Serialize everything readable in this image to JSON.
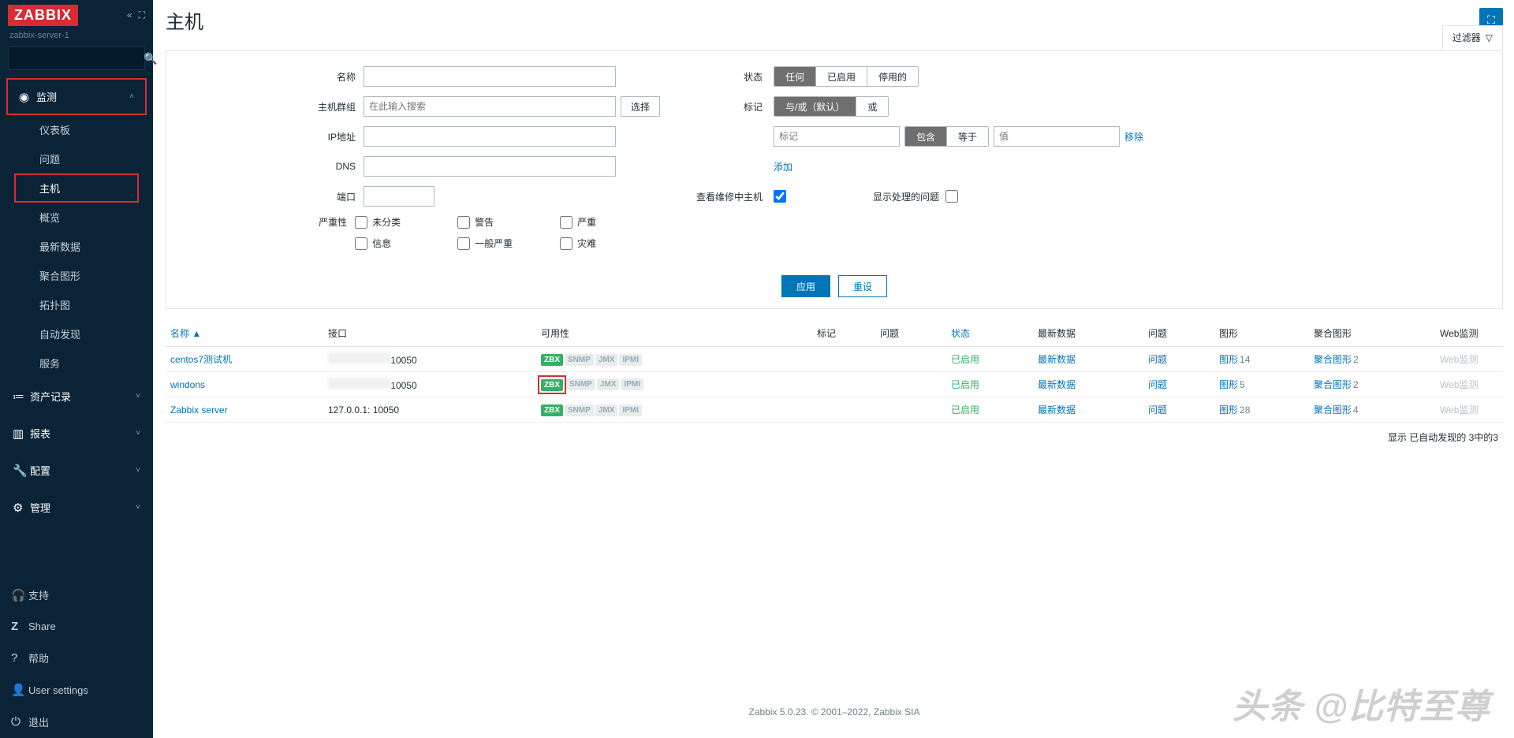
{
  "brand": "ZABBIX",
  "server_name": "zabbix-server-1",
  "page_title": "主机",
  "filter_tab": "过滤器",
  "nav": {
    "sections": [
      {
        "icon": "◉",
        "label": "监测",
        "expanded": true,
        "highlight": true,
        "items": [
          "仪表板",
          "问题",
          "主机",
          "概览",
          "最新数据",
          "聚合图形",
          "拓扑图",
          "自动发现",
          "服务"
        ],
        "highlight_item": "主机"
      },
      {
        "icon": "≔",
        "label": "资产记录"
      },
      {
        "icon": "⬛",
        "label": "报表"
      },
      {
        "icon": "🔧",
        "label": "配置"
      },
      {
        "icon": "⚙",
        "label": "管理"
      }
    ],
    "footer": [
      {
        "icon": "🎧",
        "label": "支持"
      },
      {
        "icon": "Z",
        "label": "Share"
      },
      {
        "icon": "?",
        "label": "帮助"
      },
      {
        "icon": "👤",
        "label": "User settings"
      },
      {
        "icon": "⏻",
        "label": "退出"
      }
    ]
  },
  "filter": {
    "labels": {
      "name": "名称",
      "hostgroup": "主机群组",
      "ip": "IP地址",
      "dns": "DNS",
      "port": "端口",
      "severity": "严重性",
      "status": "状态",
      "tags": "标记",
      "maint": "查看维修中主机",
      "show_issues": "显示处理的问题"
    },
    "hostgroup_placeholder": "在此输入搜索",
    "select_btn": "选择",
    "status_opts": [
      "任何",
      "已启用",
      "停用的"
    ],
    "status_selected": "任何",
    "tag_mode_opts": [
      "与/或（默认）",
      "或"
    ],
    "tag_mode_selected": "与/或（默认）",
    "tag_key_placeholder": "标记",
    "tag_op_opts": [
      "包含",
      "等于"
    ],
    "tag_op_selected": "包含",
    "tag_val_placeholder": "值",
    "tag_remove": "移除",
    "tag_add": "添加",
    "maint_checked": true,
    "show_issues_checked": false,
    "severities": [
      "未分类",
      "警告",
      "严重",
      "信息",
      "一般严重",
      "灾难"
    ],
    "apply": "应用",
    "reset": "重设"
  },
  "table": {
    "headers": {
      "name": "名称",
      "interface": "接口",
      "avail": "可用性",
      "tags": "标记",
      "problems": "问题",
      "status": "状态",
      "latest": "最新数据",
      "problems2": "问题",
      "graphs": "图形",
      "screens": "聚合图形",
      "web": "Web监测"
    },
    "sort_indicator": "▲",
    "avail_tags": [
      "ZBX",
      "SNMP",
      "JMX",
      "IPMI"
    ],
    "rows": [
      {
        "name": "centos7测试机",
        "interface_port": "10050",
        "interface_blur": true,
        "zbx_hl": false,
        "status": "已启用",
        "latest": "最新数据",
        "problems": "问题",
        "graphs": "图形",
        "graphs_n": "14",
        "screens": "聚合图形",
        "screens_n": "2",
        "web": "Web监测"
      },
      {
        "name": "windons",
        "interface_port": "10050",
        "interface_blur": true,
        "zbx_hl": true,
        "status": "已启用",
        "latest": "最新数据",
        "problems": "问题",
        "graphs": "图形",
        "graphs_n": "5",
        "screens": "聚合图形",
        "screens_n": "2",
        "web": "Web监测"
      },
      {
        "name": "Zabbix server",
        "interface": "127.0.0.1: 10050",
        "interface_blur": false,
        "zbx_hl": false,
        "status": "已启用",
        "latest": "最新数据",
        "problems": "问题",
        "graphs": "图形",
        "graphs_n": "28",
        "screens": "聚合图形",
        "screens_n": "4",
        "web": "Web监测"
      }
    ],
    "footer": "显示 已自动发现的 3中的3"
  },
  "page_footer": "Zabbix 5.0.23. © 2001–2022, Zabbix SIA",
  "watermark": "头条 @比特至尊"
}
